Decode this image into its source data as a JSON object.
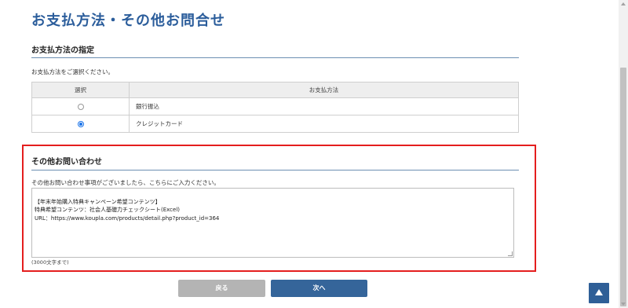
{
  "page": {
    "title": "お支払方法・その他お問合せ"
  },
  "payment": {
    "section_title": "お支払方法の指定",
    "description": "お支払方法をご選択ください。",
    "headers": {
      "select": "選択",
      "method": "お支払方法"
    },
    "options": [
      {
        "label": "銀行振込",
        "selected": false
      },
      {
        "label": "クレジットカード",
        "selected": true
      }
    ]
  },
  "inquiry": {
    "section_title": "その他お問い合わせ",
    "description": "その他お問い合わせ事項がございましたら、こちらにご入力ください。",
    "textarea_value": "【年末年始購入特典キャンペーン希望コンテンツ】\n特典希望コンテンツ：社会人基礎力チェックシート(Excel)\nURL：https://www.koupla.com/products/detail.php?product_id=364",
    "limit_note": "(3000文字まで)"
  },
  "buttons": {
    "back": "戻る",
    "next": "次へ"
  },
  "colors": {
    "title": "#2b5d9b",
    "highlight_border": "#e41e1e",
    "next_button": "#35659a",
    "back_button": "#b4b4b4"
  },
  "icons": {
    "scroll_top": "arrow-up-icon"
  }
}
